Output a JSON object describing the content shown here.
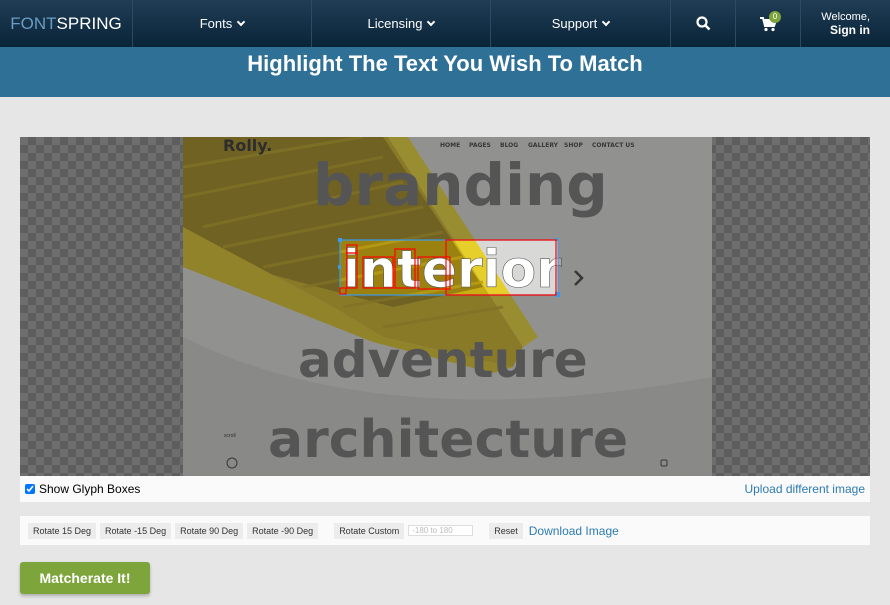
{
  "nav": {
    "logo_a": "FONT",
    "logo_b": "SPRING",
    "items": [
      {
        "label": "Fonts"
      },
      {
        "label": "Licensing"
      },
      {
        "label": "Support"
      }
    ],
    "cart_count": "0",
    "welcome": "Welcome,",
    "sign_in": "Sign in"
  },
  "page": {
    "title": "Highlight The Text You Wish To Match"
  },
  "image": {
    "brand": "Rolly.",
    "menu": [
      "HOME",
      "PAGES",
      "BLOG",
      "GALLERY",
      "SHOP",
      "CONTACT US"
    ],
    "words": [
      "branding",
      "interior",
      "adventure",
      "architecture"
    ],
    "scroll": "scroll"
  },
  "options": {
    "show_glyph_boxes": "Show Glyph Boxes",
    "show_glyph_boxes_checked": true,
    "upload": "Upload different image"
  },
  "toolbar": {
    "rot15": "Rotate 15 Deg",
    "rotm15": "Rotate -15 Deg",
    "rot90": "Rotate 90 Deg",
    "rotm90": "Rotate -90 Deg",
    "custom": "Rotate Custom",
    "custom_placeholder": "-180 to 180",
    "reset": "Reset",
    "download": "Download Image"
  },
  "action": {
    "label": "Matcherate It!"
  },
  "colors": {
    "accent_green": "#7ea53c",
    "link": "#2d7bb0",
    "band": "#2f7096",
    "selection": "#3a9be8",
    "glyph_box": "#ff0000"
  }
}
